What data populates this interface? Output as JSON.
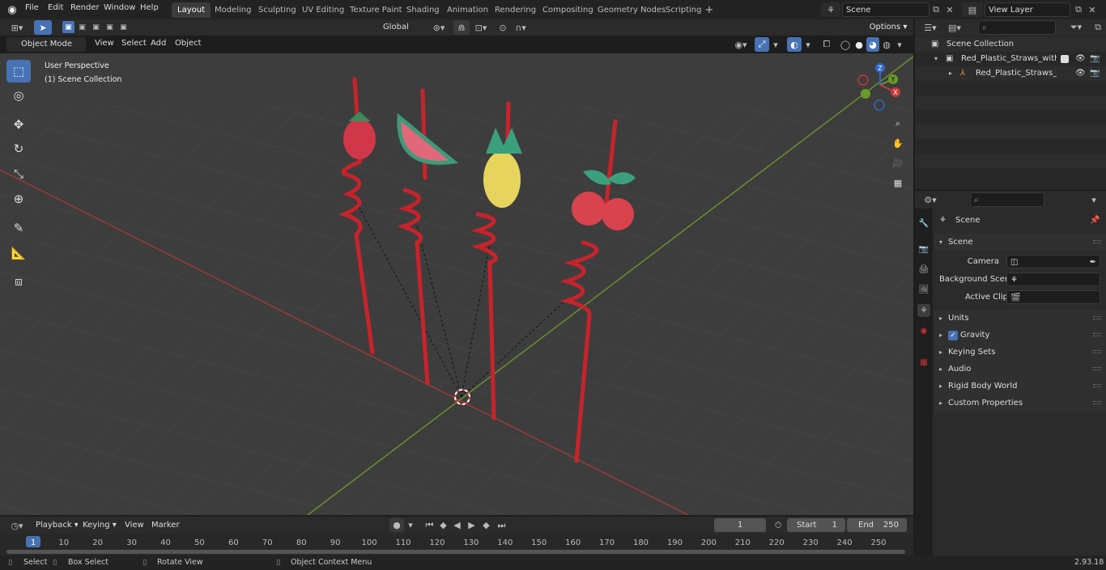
{
  "menu": {
    "file": "File",
    "edit": "Edit",
    "render": "Render",
    "window": "Window",
    "help": "Help"
  },
  "workspaces": [
    "Layout",
    "Modeling",
    "Sculpting",
    "UV Editing",
    "Texture Paint",
    "Shading",
    "Animation",
    "Rendering",
    "Compositing",
    "Geometry Nodes",
    "Scripting"
  ],
  "scene_name": "Scene",
  "view_layer": "View Layer",
  "header": {
    "transform_orientation": "Global",
    "options": "Options"
  },
  "viewport_header": {
    "mode": "Object Mode",
    "view": "View",
    "select": "Select",
    "add": "Add",
    "object": "Object"
  },
  "viewport": {
    "perspective": "User Perspective",
    "collection": "(1) Scene Collection"
  },
  "gizmo": {
    "x": "X",
    "y": "Y",
    "z": "Z"
  },
  "outliner": {
    "root": "Scene Collection",
    "collection": "Red_Plastic_Straws_with_Frui",
    "object": "Red_Plastic_Straws_with_"
  },
  "properties": {
    "context": "Scene",
    "panel": "Scene",
    "camera_label": "Camera",
    "bg_scene_label": "Background Scene",
    "active_clip_label": "Active Clip",
    "subpanels": [
      "Units",
      "Gravity",
      "Keying Sets",
      "Audio",
      "Rigid Body World",
      "Custom Properties"
    ],
    "gravity_checked": true
  },
  "timeline": {
    "playback": "Playback",
    "keying": "Keying",
    "view": "View",
    "marker": "Marker",
    "current_frame": "1",
    "start_label": "Start",
    "start": "1",
    "end_label": "End",
    "end": "250",
    "ticks": [
      "1",
      "10",
      "20",
      "30",
      "40",
      "50",
      "60",
      "70",
      "80",
      "90",
      "100",
      "110",
      "120",
      "130",
      "140",
      "150",
      "160",
      "170",
      "180",
      "190",
      "200",
      "210",
      "220",
      "230",
      "240",
      "250"
    ]
  },
  "status": {
    "select": "Select",
    "box_select": "Box Select",
    "rotate": "Rotate View",
    "context_menu": "Object Context Menu",
    "version": "2.93.18"
  },
  "colors": {
    "accent": "#4772b3",
    "active_frame": "#4772b3",
    "x_axis": "#b03a3a",
    "y_axis": "#7fa53a",
    "straw": "#c8232c"
  }
}
